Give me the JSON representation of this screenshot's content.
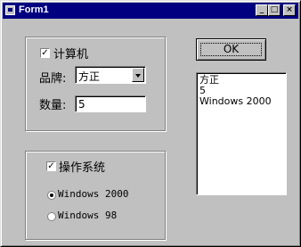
{
  "window": {
    "title": "Form1",
    "buttons": {
      "minimize": "_",
      "maximize": "□",
      "close": "×"
    }
  },
  "product_frame": {
    "computer_checkbox": {
      "label": "计算机",
      "checked": true,
      "mark": "✓"
    },
    "brand": {
      "label": "品牌:",
      "value": "方正"
    },
    "quantity": {
      "label": "数量:",
      "value": "5"
    }
  },
  "os_frame": {
    "os_checkbox": {
      "label": "操作系统",
      "checked": true,
      "mark": "✓"
    },
    "options": [
      {
        "label": "Windows 2000",
        "selected": true
      },
      {
        "label": "Windows 98",
        "selected": false
      }
    ]
  },
  "ok_button": {
    "label": "OK"
  },
  "output_list": [
    "方正",
    "5",
    "Windows 2000"
  ]
}
